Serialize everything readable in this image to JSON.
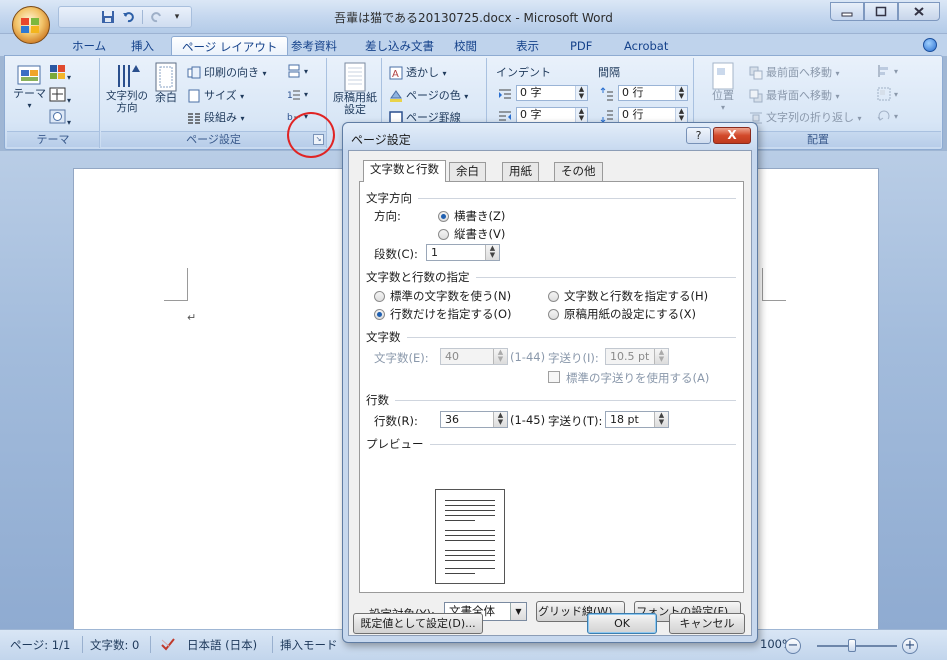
{
  "window": {
    "title": "吾輩は猫である20130725.docx - Microsoft Word"
  },
  "ribbon_tabs": [
    "ホーム",
    "挿入",
    "ページ レイアウト",
    "参考資料",
    "差し込み文書",
    "校閲",
    "表示",
    "PDF",
    "Acrobat"
  ],
  "ribbon": {
    "themes": {
      "theme_label": "テーマ",
      "group_label": "テーマ"
    },
    "page_setup": {
      "text_direction": "文字列の方向",
      "margins": "余白",
      "orientation": "印刷の向き",
      "size": "サイズ",
      "columns": "段組み",
      "group_label": "ページ設定"
    },
    "manuscript": {
      "label": "原稿用紙設定"
    },
    "background": {
      "watermark": "透かし",
      "page_color": "ページの色",
      "page_borders": "ページ罫線"
    },
    "paragraph": {
      "indent_label": "インデント",
      "spacing_label": "間隔",
      "indent_left": "0 字",
      "indent_right": "0 字",
      "space_before": "0 行",
      "space_after": "0 行"
    },
    "arrange": {
      "position": "位置",
      "bring_front": "最前面へ移動",
      "send_back": "最背面へ移動",
      "text_wrap": "文字列の折り返し",
      "group_label": "配置"
    }
  },
  "dialog": {
    "title": "ページ設定",
    "help": "?",
    "close": "X",
    "tabs": [
      "文字数と行数",
      "余白",
      "用紙",
      "その他"
    ],
    "text_direction": {
      "section": "文字方向",
      "direction_label": "方向:",
      "horizontal": "横書き(Z)",
      "vertical": "縦書き(V)",
      "columns_label": "段数(C):",
      "columns_value": "1"
    },
    "grid": {
      "section": "文字数と行数の指定",
      "standard": "標準の文字数を使う(N)",
      "specify_both": "文字数と行数を指定する(H)",
      "lines_only": "行数だけを指定する(O)",
      "manuscript": "原稿用紙の設定にする(X)"
    },
    "chars": {
      "section": "文字数",
      "chars_label": "文字数(E):",
      "chars_value": "40",
      "chars_range": "(1-44)",
      "pitch_label": "字送り(I):",
      "pitch_value": "10.5 pt",
      "use_default_pitch": "標準の字送りを使用する(A)"
    },
    "lines": {
      "section": "行数",
      "lines_label": "行数(R):",
      "lines_value": "36",
      "lines_range": "(1-45)",
      "pitch_label": "字送り(T):",
      "pitch_value": "18 pt"
    },
    "preview": {
      "section": "プレビュー"
    },
    "apply_to_label": "設定対象(Y):",
    "apply_to_value": "文書全体",
    "grid_button": "グリッド線(W)...",
    "font_button": "フォントの設定(F)...",
    "default_button": "既定値として設定(D)...",
    "ok": "OK",
    "cancel": "キャンセル"
  },
  "statusbar": {
    "page": "ページ: 1/1",
    "words": "文字数: 0",
    "language": "日本語 (日本)",
    "mode": "挿入モード",
    "zoom": "100%"
  },
  "colors": {
    "accent": "#15428b",
    "highlight_circle": "#e02424",
    "close_button": "#d2492a"
  }
}
